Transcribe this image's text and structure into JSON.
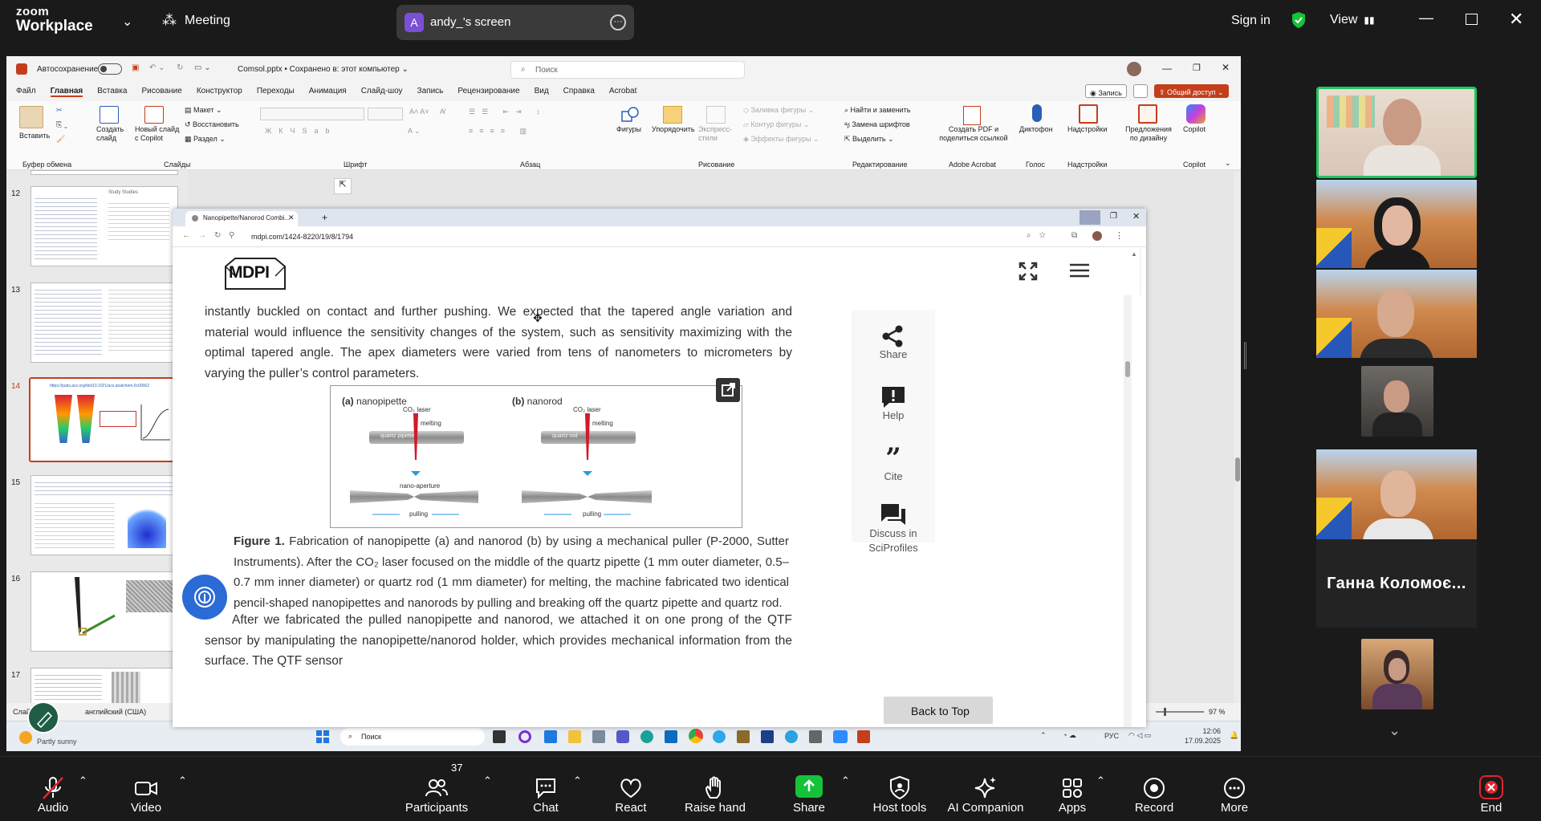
{
  "zoom": {
    "logo_line1": "zoom",
    "logo_line2": "Workplace",
    "meeting_label": "Meeting",
    "share_avatar": "A",
    "share_title": "andy_'s screen",
    "sign_in": "Sign in",
    "view": "View",
    "participant_name": "Ганна Коломоє...",
    "participants_count": "37",
    "controls": [
      {
        "label": "Audio"
      },
      {
        "label": "Video"
      },
      {
        "label": "Participants"
      },
      {
        "label": "Chat"
      },
      {
        "label": "React"
      },
      {
        "label": "Raise hand"
      },
      {
        "label": "Share"
      },
      {
        "label": "Host tools"
      },
      {
        "label": "AI Companion"
      },
      {
        "label": "Apps"
      },
      {
        "label": "Record"
      },
      {
        "label": "More"
      },
      {
        "label": "End"
      }
    ],
    "colors": {
      "share_green": "#16c23a",
      "end_red": "#e0262d",
      "active_border": "#22c55e"
    }
  },
  "ppt": {
    "autosave": "Автосохранение",
    "filename": "Comsol.pptx • Сохранено в: этот компьютер ⌄",
    "search_placeholder": "Поиск",
    "menu": [
      "Файл",
      "Главная",
      "Вставка",
      "Рисование",
      "Конструктор",
      "Переходы",
      "Анимация",
      "Слайд-шоу",
      "Запись",
      "Рецензирование",
      "Вид",
      "Справка",
      "Acrobat"
    ],
    "record_btn": "Запись",
    "share_btn": "Общий доступ",
    "ribbon": {
      "paste": "Вставить",
      "clipboard": "Буфер обмена",
      "create_slide": "Создать слайд",
      "new_slide_copilot": "Новый слайд с Copilot",
      "layout": "Макет",
      "reset": "Восстановить",
      "section": "Раздел",
      "slides": "Слайды",
      "font": "Шрифт",
      "paragraph": "Абзац",
      "shapes": "Фигуры",
      "arrange": "Упорядочить",
      "express_styles": "Экспресс-стили",
      "shape_fill": "Заливка фигуры",
      "shape_outline": "Контур фигуры",
      "shape_effects": "Эффекты фигуры",
      "drawing": "Рисование",
      "find_replace": "Найти и заменить",
      "replace_fonts": "Замена шрифтов",
      "select": "Выделить",
      "editing": "Редактирование",
      "create_pdf": "Создать PDF и поделиться ссылкой",
      "adobe": "Adobe Acrobat",
      "dictate": "Диктофон",
      "voice": "Голос",
      "addins": "Надстройки",
      "addins_group": "Надстройки",
      "design_ideas": "Предложения по дизайну",
      "copilot": "Copilot",
      "copilot_group": "Copilot"
    },
    "slide_numbers": [
      "12",
      "13",
      "14",
      "15",
      "16",
      "17"
    ],
    "slide12_title": "Study Studies",
    "slide14_url": "https://pubs.acs.org/doi/10.1021/acs.analchem.6c00062",
    "status_left": "Слай",
    "status_lang": "английский (США)",
    "zoom_pct": "97 %"
  },
  "browser": {
    "tab_title": "Nanopipette/Nanorod Combi...",
    "url": "mdpi.com/1424-8220/19/8/1794",
    "logo": "MDPI",
    "paragraph1": "instantly buckled on contact and further pushing. We expected that the tapered angle variation and material would influence the sensitivity changes of the system, such as sensitivity maximizing with the optimal tapered angle. The apex diameters were varied from tens of nanometers to micrometers by varying the puller’s control parameters.",
    "figure": {
      "a_label": "(a)",
      "a_title": "nanopipette",
      "b_label": "(b)",
      "b_title": "nanorod",
      "laser": "CO₂ laser",
      "melting": "melting",
      "quartz_pipette": "quartz pipette",
      "quartz_rod": "quartz rod",
      "nano_aperture": "nano-aperture",
      "pulling": "pulling"
    },
    "caption_bold": "Figure 1.",
    "caption_text": "Fabrication of nanopipette (a) and nanorod (b) by using a mechanical puller (P-2000, Sutter Instruments). After the CO₂ laser focused on the middle of the quartz pipette (1 mm outer diameter, 0.5–0.7 mm inner diameter) or quartz rod (1 mm diameter) for melting, the machine fabricated two identical pencil-shaped nanopipettes and nanorods by pulling and breaking off the quartz pipette and quartz rod.",
    "paragraph2": "After we fabricated the pulled nanopipette and nanorod, we attached it on one prong of the QTF sensor by manipulating the nanopipette/nanorod holder, which provides mechanical information from the surface. The QTF sensor",
    "side": {
      "share": "Share",
      "help": "Help",
      "cite": "Cite",
      "discuss1": "Discuss in",
      "discuss2": "SciProfiles"
    },
    "back_to_top": "Back to Top"
  },
  "taskbar": {
    "weather": "Partly sunny",
    "search": "Поиск",
    "lang": "РУС",
    "time": "12:06",
    "date": "17.09.2025"
  }
}
